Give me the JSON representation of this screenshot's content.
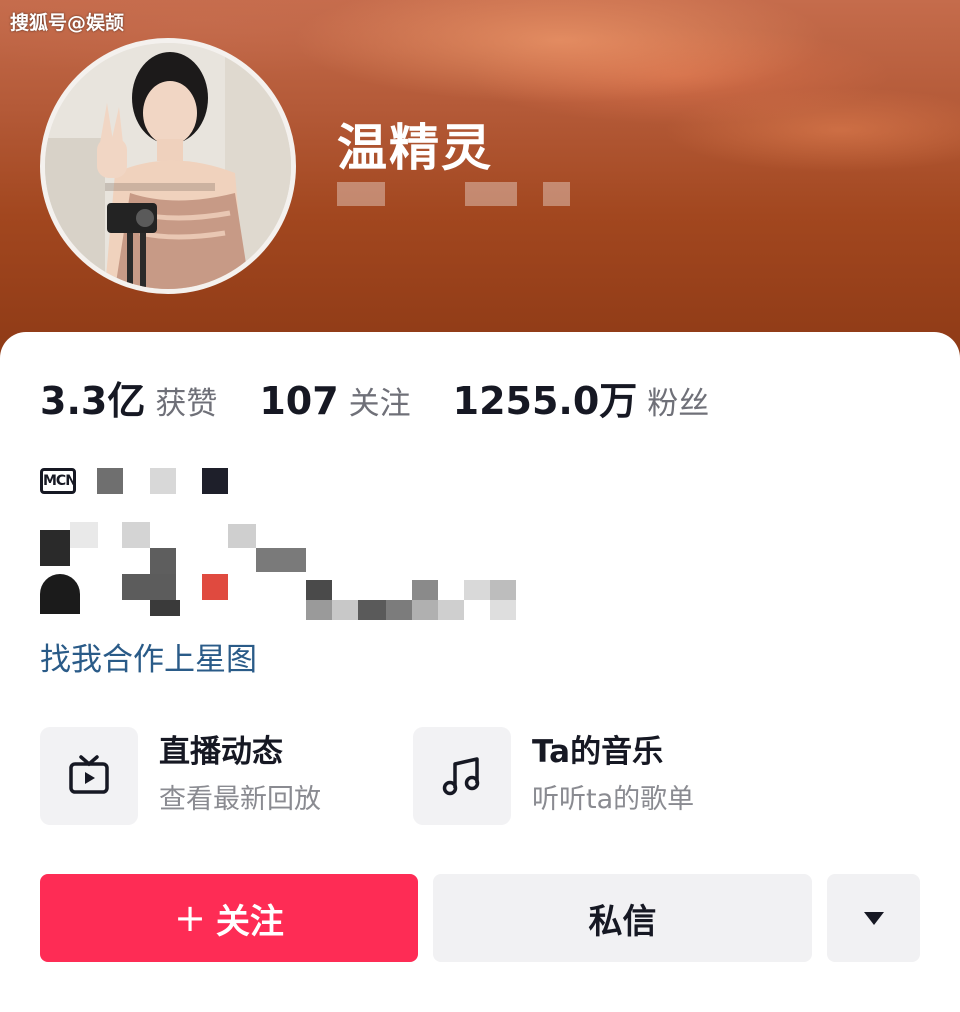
{
  "watermark": "搜狐号@娱颉",
  "profile": {
    "name": "温精灵",
    "avatar_icon": "profile-photo"
  },
  "stats": [
    {
      "value": "3.3亿",
      "label": "获赞"
    },
    {
      "value": "107",
      "label": "关注"
    },
    {
      "value": "1255.0万",
      "label": "粉丝"
    }
  ],
  "bio": {
    "mcn_badge": "MCN",
    "xingtu_link": "找我合作上星图"
  },
  "features": [
    {
      "title": "直播动态",
      "subtitle": "查看最新回放",
      "icon": "tv-icon"
    },
    {
      "title": "Ta的音乐",
      "subtitle": "听听ta的歌单",
      "icon": "music-note-icon"
    }
  ],
  "actions": {
    "follow_plus": "+",
    "follow_label": "关注",
    "message_label": "私信",
    "more_icon": "triangle-down-icon"
  },
  "colors": {
    "accent": "#fe2c55",
    "link": "#2a5b88",
    "header_bg": "#a2471f"
  }
}
